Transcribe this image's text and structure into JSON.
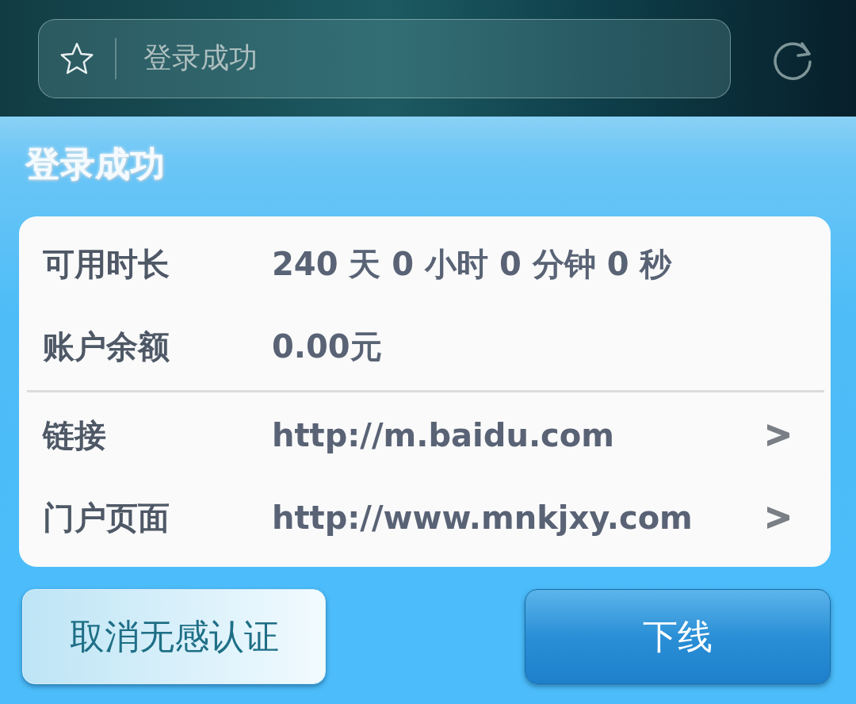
{
  "address_bar": {
    "value": "登录成功"
  },
  "page_title": "登录成功",
  "info_rows": [
    {
      "label": "可用时长",
      "value": "240 天 0 小时 0 分钟 0 秒"
    },
    {
      "label": "账户余额",
      "value": "0.00元"
    }
  ],
  "link_rows": [
    {
      "label": "链接",
      "value": "http://m.baidu.com"
    },
    {
      "label": "门户页面",
      "value": "http://www.mnkjxy.com"
    }
  ],
  "buttons": [
    {
      "label": "取消无感认证",
      "kind": "secondary"
    },
    {
      "label": "下线",
      "kind": "primary"
    }
  ]
}
